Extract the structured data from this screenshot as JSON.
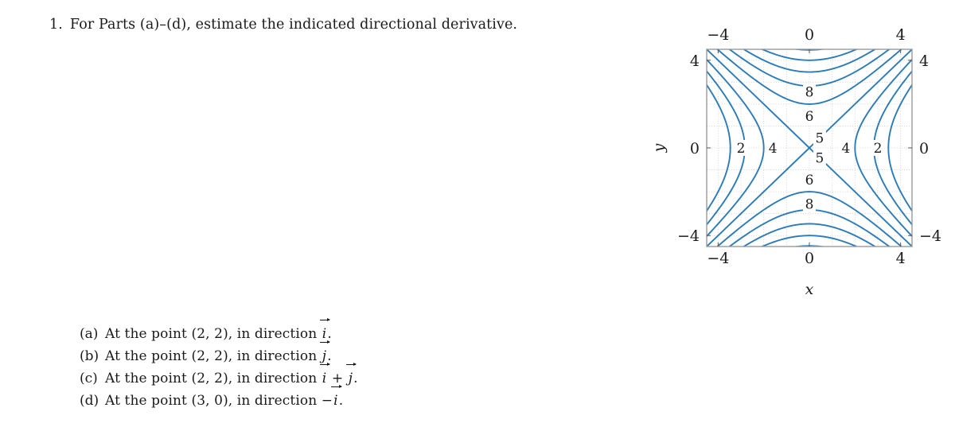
{
  "problem": {
    "number": "1.",
    "text": "For Parts (a)–(d), estimate the indicated directional derivative."
  },
  "parts": [
    {
      "label": "(a)",
      "prefix": "At the point (2, 2), in direction ",
      "dir_pre": "",
      "vec1": "i",
      "op": "",
      "vec2": "",
      "suffix": "."
    },
    {
      "label": "(b)",
      "prefix": "At the point (2, 2), in direction ",
      "dir_pre": "",
      "vec1": "j",
      "op": "",
      "vec2": "",
      "suffix": "."
    },
    {
      "label": "(c)",
      "prefix": "At the point (2, 2), in direction ",
      "dir_pre": "",
      "vec1": "i",
      "op": " + ",
      "vec2": "j",
      "suffix": "."
    },
    {
      "label": "(d)",
      "prefix": "At the point (3, 0), in direction ",
      "dir_pre": "−",
      "vec1": "i",
      "op": "",
      "vec2": "",
      "suffix": "."
    }
  ],
  "figure": {
    "xlabel": "x",
    "ylabel": "y",
    "top_ticks": [
      {
        "text": "−4",
        "value": -4
      },
      {
        "text": "0",
        "value": 0
      },
      {
        "text": "4",
        "value": 4
      }
    ],
    "bottom_ticks": [
      {
        "text": "−4",
        "value": -4
      },
      {
        "text": "0",
        "value": 0
      },
      {
        "text": "4",
        "value": 4
      }
    ],
    "left_ticks": [
      {
        "text": "4",
        "value": 4
      },
      {
        "text": "0",
        "value": 0
      },
      {
        "text": "−4",
        "value": -4
      }
    ],
    "right_ticks": [
      {
        "text": "4",
        "value": 4
      },
      {
        "text": "0",
        "value": 0
      },
      {
        "text": "−4",
        "value": -4
      }
    ],
    "contour_color": "#2b7bb9",
    "grid_color": "#cccccc",
    "frame_color": "#9a9a9a"
  },
  "chart_data": {
    "type": "contour",
    "title": "",
    "xlabel": "x",
    "ylabel": "y",
    "xlim": [
      -4.5,
      4.5
    ],
    "ylim": [
      -4.5,
      4.5
    ],
    "xticks": [
      -4,
      0,
      4
    ],
    "yticks": [
      -4,
      0,
      4
    ],
    "grid": true,
    "grid_step": 1,
    "function": "f(x,y) = 5 + 0.25*(y^2 - x^2)",
    "saddle_point": [
      0,
      0
    ],
    "saddle_value": 5,
    "levels": [
      2,
      3,
      4,
      5,
      6,
      7,
      8,
      9,
      10
    ],
    "labeled_levels": [
      {
        "level": 8,
        "label": "8",
        "at": [
          0,
          2.55
        ]
      },
      {
        "level": 6,
        "label": "6",
        "at": [
          0,
          1.45
        ]
      },
      {
        "level": 5,
        "label": "5",
        "at": [
          0.45,
          0.45
        ]
      },
      {
        "level": 5,
        "label": "5",
        "at": [
          0.45,
          -0.45
        ]
      },
      {
        "level": 6,
        "label": "6",
        "at": [
          0,
          -1.45
        ]
      },
      {
        "level": 8,
        "label": "8",
        "at": [
          0,
          -2.55
        ]
      },
      {
        "level": 2,
        "label": "2",
        "at": [
          -3.0,
          0
        ]
      },
      {
        "level": 4,
        "label": "4",
        "at": [
          -1.6,
          0
        ]
      },
      {
        "level": 4,
        "label": "4",
        "at": [
          1.6,
          0
        ]
      },
      {
        "level": 2,
        "label": "2",
        "at": [
          3.0,
          0
        ]
      }
    ],
    "legend": null
  }
}
